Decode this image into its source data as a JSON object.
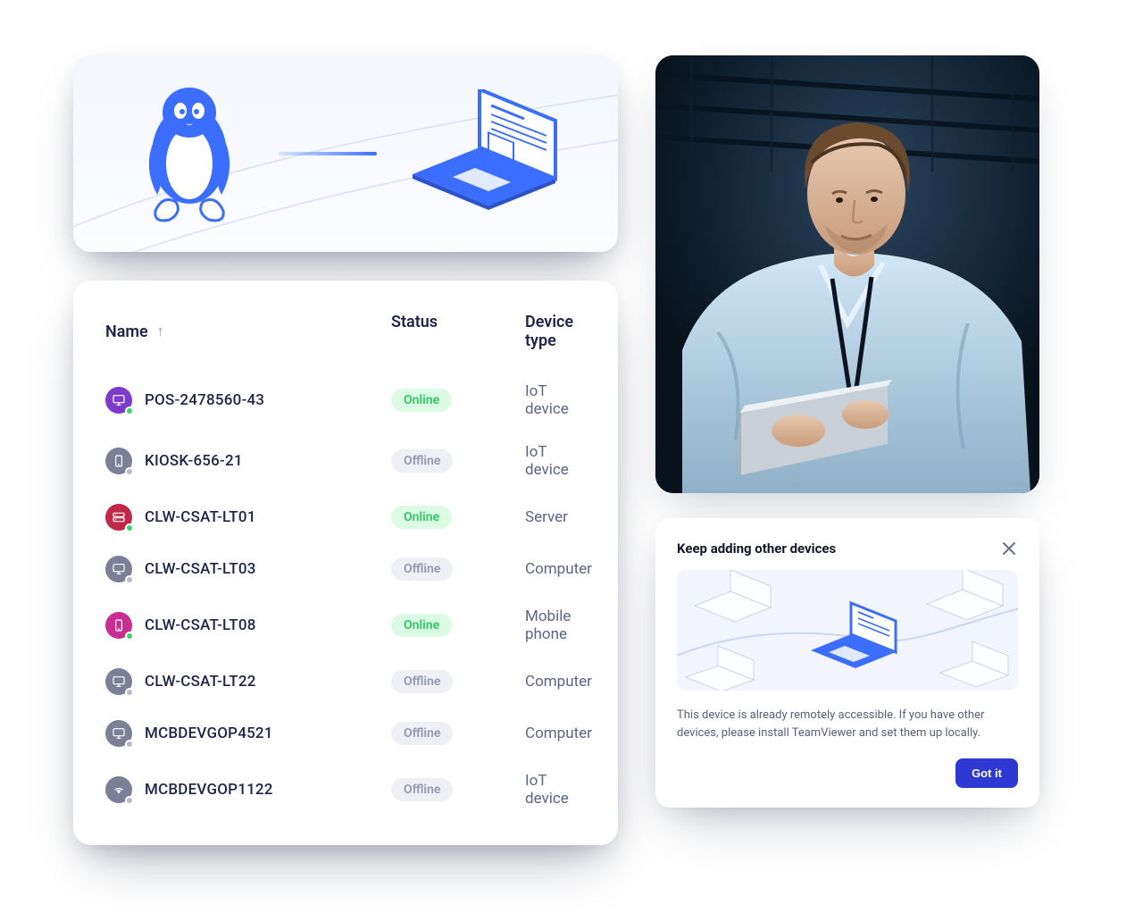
{
  "table": {
    "columns": {
      "name": "Name",
      "status": "Status",
      "type": "Device type"
    },
    "rows": [
      {
        "name": "POS-2478560-43",
        "status": "Online",
        "type": "IoT device",
        "iconClass": "ic-purple",
        "iconGlyph": "monitor"
      },
      {
        "name": "KIOSK-656-21",
        "status": "Offline",
        "type": "IoT device",
        "iconClass": "ic-gray",
        "iconGlyph": "phone"
      },
      {
        "name": "CLW-CSAT-LT01",
        "status": "Online",
        "type": "Server",
        "iconClass": "ic-red",
        "iconGlyph": "server"
      },
      {
        "name": "CLW-CSAT-LT03",
        "status": "Offline",
        "type": "Computer",
        "iconClass": "ic-gray",
        "iconGlyph": "monitor"
      },
      {
        "name": "CLW-CSAT-LT08",
        "status": "Online",
        "type": "Mobile phone",
        "iconClass": "ic-pink",
        "iconGlyph": "phone"
      },
      {
        "name": "CLW-CSAT-LT22",
        "status": "Offline",
        "type": "Computer",
        "iconClass": "ic-gray",
        "iconGlyph": "monitor"
      },
      {
        "name": "MCBDEVGOP4521",
        "status": "Offline",
        "type": "Computer",
        "iconClass": "ic-gray",
        "iconGlyph": "monitor"
      },
      {
        "name": "MCBDEVGOP1122",
        "status": "Offline",
        "type": "IoT device",
        "iconClass": "ic-gray",
        "iconGlyph": "iot"
      }
    ]
  },
  "dialog": {
    "title": "Keep adding other devices",
    "body": "This device is already remotely accessible. If you have other devices, please install TeamViewer and set them up locally.",
    "cta": "Got it"
  }
}
